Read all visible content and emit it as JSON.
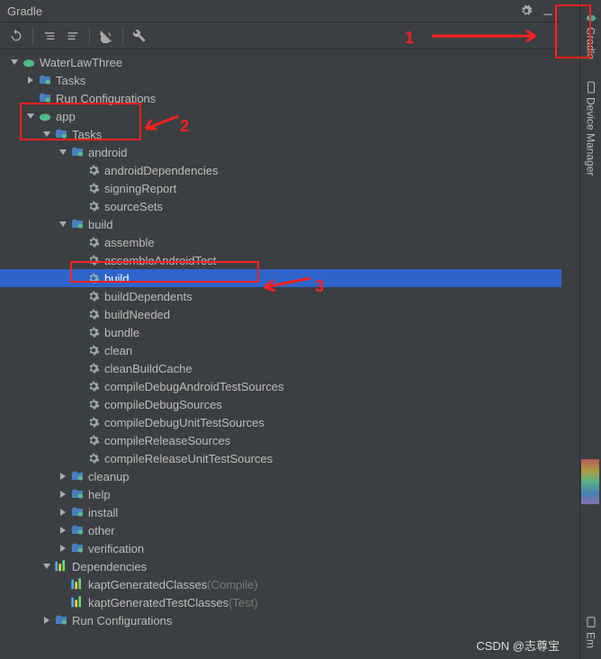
{
  "header": {
    "title": "Gradle"
  },
  "watermark": "CSDN @志尊宝",
  "right_tabs": [
    {
      "label": "Gradle"
    },
    {
      "label": "Device Manager"
    },
    {
      "label": "Em"
    }
  ],
  "annotations": {
    "a1": "1",
    "a2": "2",
    "a3": "3"
  },
  "tree": [
    {
      "depth": 0,
      "arrow": "expanded",
      "icon": "gradle",
      "label": "WaterLawThree"
    },
    {
      "depth": 1,
      "arrow": "collapsed",
      "icon": "folder-gradle",
      "label": "Tasks"
    },
    {
      "depth": 1,
      "arrow": "none",
      "icon": "folder-gradle",
      "label": "Run Configurations"
    },
    {
      "depth": 1,
      "arrow": "expanded",
      "icon": "gradle",
      "label": "app"
    },
    {
      "depth": 2,
      "arrow": "expanded",
      "icon": "folder-gradle",
      "label": "Tasks"
    },
    {
      "depth": 3,
      "arrow": "expanded",
      "icon": "folder-gradle",
      "label": "android"
    },
    {
      "depth": 4,
      "arrow": "none",
      "icon": "gear",
      "label": "androidDependencies"
    },
    {
      "depth": 4,
      "arrow": "none",
      "icon": "gear",
      "label": "signingReport"
    },
    {
      "depth": 4,
      "arrow": "none",
      "icon": "gear",
      "label": "sourceSets"
    },
    {
      "depth": 3,
      "arrow": "expanded",
      "icon": "folder-gradle",
      "label": "build"
    },
    {
      "depth": 4,
      "arrow": "none",
      "icon": "gear",
      "label": "assemble"
    },
    {
      "depth": 4,
      "arrow": "none",
      "icon": "gear",
      "label": "assembleAndroidTest"
    },
    {
      "depth": 4,
      "arrow": "none",
      "icon": "gear",
      "label": "build",
      "selected": true
    },
    {
      "depth": 4,
      "arrow": "none",
      "icon": "gear",
      "label": "buildDependents"
    },
    {
      "depth": 4,
      "arrow": "none",
      "icon": "gear",
      "label": "buildNeeded"
    },
    {
      "depth": 4,
      "arrow": "none",
      "icon": "gear",
      "label": "bundle"
    },
    {
      "depth": 4,
      "arrow": "none",
      "icon": "gear",
      "label": "clean"
    },
    {
      "depth": 4,
      "arrow": "none",
      "icon": "gear",
      "label": "cleanBuildCache"
    },
    {
      "depth": 4,
      "arrow": "none",
      "icon": "gear",
      "label": "compileDebugAndroidTestSources"
    },
    {
      "depth": 4,
      "arrow": "none",
      "icon": "gear",
      "label": "compileDebugSources"
    },
    {
      "depth": 4,
      "arrow": "none",
      "icon": "gear",
      "label": "compileDebugUnitTestSources"
    },
    {
      "depth": 4,
      "arrow": "none",
      "icon": "gear",
      "label": "compileReleaseSources"
    },
    {
      "depth": 4,
      "arrow": "none",
      "icon": "gear",
      "label": "compileReleaseUnitTestSources"
    },
    {
      "depth": 3,
      "arrow": "collapsed",
      "icon": "folder-gradle",
      "label": "cleanup"
    },
    {
      "depth": 3,
      "arrow": "collapsed",
      "icon": "folder-gradle",
      "label": "help"
    },
    {
      "depth": 3,
      "arrow": "collapsed",
      "icon": "folder-gradle",
      "label": "install"
    },
    {
      "depth": 3,
      "arrow": "collapsed",
      "icon": "folder-gradle",
      "label": "other"
    },
    {
      "depth": 3,
      "arrow": "collapsed",
      "icon": "folder-gradle",
      "label": "verification"
    },
    {
      "depth": 2,
      "arrow": "expanded",
      "icon": "deps",
      "label": "Dependencies"
    },
    {
      "depth": 3,
      "arrow": "none",
      "icon": "deps",
      "label": "kaptGeneratedClasses",
      "suffix": " (Compile)"
    },
    {
      "depth": 3,
      "arrow": "none",
      "icon": "deps",
      "label": "kaptGeneratedTestClasses",
      "suffix": " (Test)"
    },
    {
      "depth": 2,
      "arrow": "collapsed",
      "icon": "folder-gradle",
      "label": "Run Configurations"
    }
  ]
}
